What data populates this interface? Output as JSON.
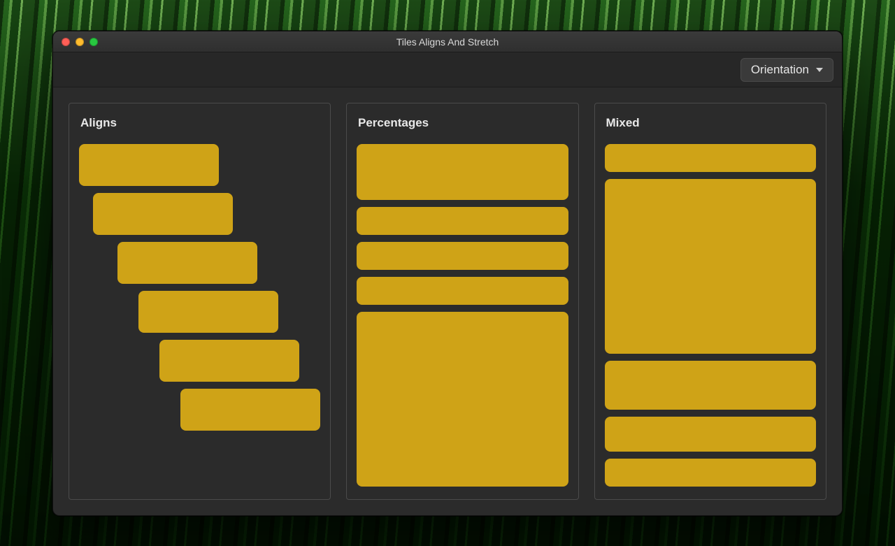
{
  "window": {
    "title": "Tiles Aligns And Stretch"
  },
  "toolbar": {
    "orientation_label": "Orientation"
  },
  "panels": {
    "aligns": {
      "title": "Aligns"
    },
    "percentages": {
      "title": "Percentages"
    },
    "mixed": {
      "title": "Mixed"
    }
  }
}
